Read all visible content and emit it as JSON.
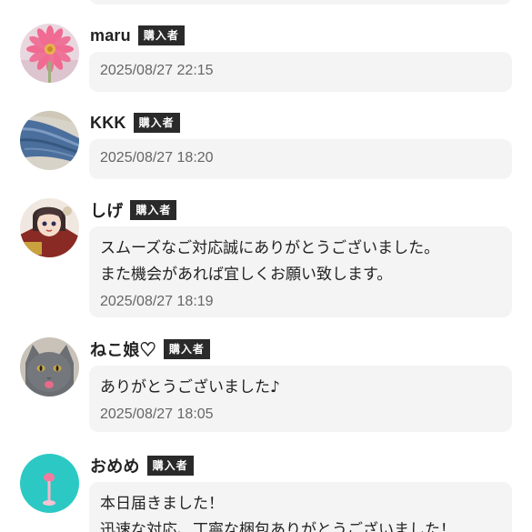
{
  "badge_label": "購入者",
  "reviews": [
    {
      "name": "maru",
      "comment": "",
      "timestamp": "2025/08/27 22:15",
      "avatar": "pink-gerbera-flower"
    },
    {
      "name": "KKK",
      "comment": "",
      "timestamp": "2025/08/27 18:20",
      "avatar": "blue-denim-fabric"
    },
    {
      "name": "しげ",
      "comment": "スムーズなご対応誠にありがとうございました。\nまた機会があれば宜しくお願い致します。",
      "timestamp": "2025/08/27 18:19",
      "avatar": "anime-character"
    },
    {
      "name": "ねこ娘♡",
      "comment": "ありがとうございました♪",
      "timestamp": "2025/08/27 18:05",
      "avatar": "gray-cat"
    },
    {
      "name": "おめめ",
      "comment": "本日届きました！\n迅速な対応、丁寧な梱包ありがとうございました！",
      "timestamp": "",
      "avatar": "turquoise-pink-item"
    }
  ],
  "colors": {
    "badge_bg": "#2a2a2a",
    "bubble_bg": "#f4f4f4",
    "timestamp": "#666666"
  }
}
